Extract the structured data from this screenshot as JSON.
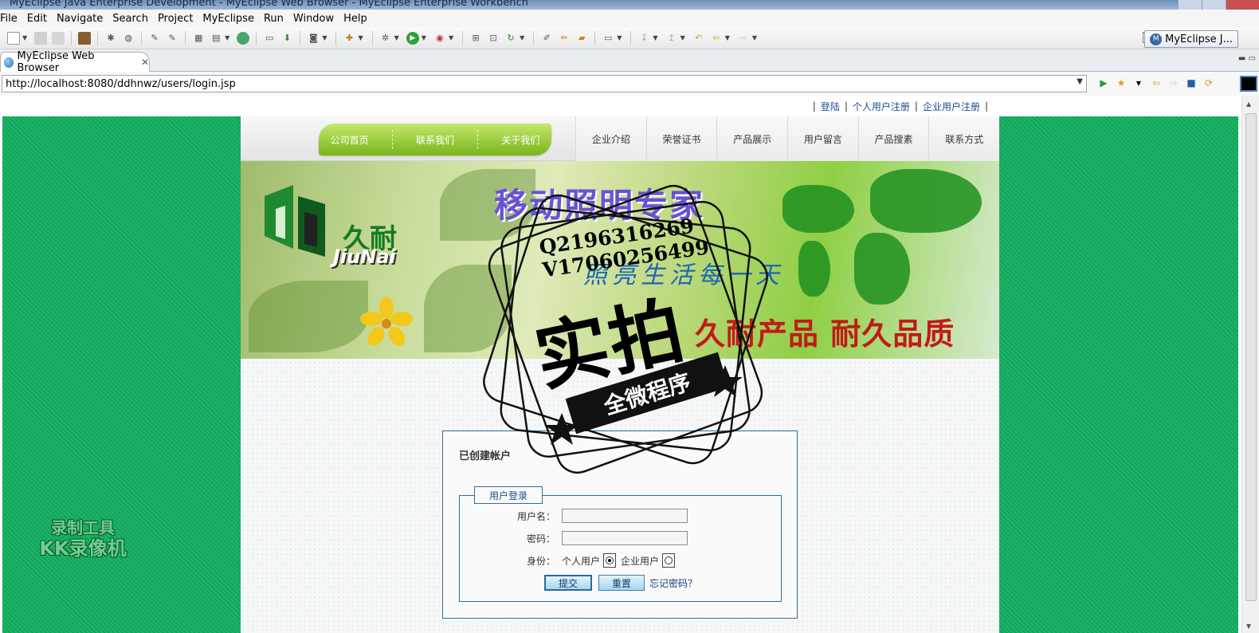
{
  "window": {
    "title": "MyEclipse Java Enterprise Development - MyEclipse Web Browser - MyEclipse Enterprise Workbench"
  },
  "menu": [
    "File",
    "Edit",
    "Navigate",
    "Search",
    "Project",
    "MyEclipse",
    "Run",
    "Window",
    "Help"
  ],
  "perspective": {
    "label": "MyEclipse J..."
  },
  "editor_tab": {
    "label": "MyEclipse Web Browser"
  },
  "url": "http://localhost:8080/ddhnwz/users/login.jsp",
  "toplinks": [
    "登陆",
    "个人用户注册",
    "企业用户注册"
  ],
  "nav": {
    "green": [
      "公司首页",
      "联系我们",
      "关于我们"
    ],
    "right": [
      "企业介绍",
      "荣誉证书",
      "产品展示",
      "用户留言",
      "产品搜素",
      "联系方式"
    ]
  },
  "banner": {
    "logo_cn": "久耐",
    "logo_en": "JiuNai",
    "title": "移动照明专家",
    "slogan": "照亮生活每一天",
    "tagline": "久耐产品 耐久品质"
  },
  "login": {
    "section_title": "已创建帐户",
    "legend": "用户登录",
    "username_label": "用户名：",
    "username_value": "",
    "password_label": "密码：",
    "password_value": "",
    "role_label": "身份：",
    "role_options": [
      "个人用户",
      "企业用户"
    ],
    "role_selected": "个人用户",
    "submit": "提交",
    "reset": "重置",
    "forgot": "忘记密码？"
  },
  "watermark": {
    "recorder_line1": "录制工具",
    "recorder_line2": "KK录像机",
    "stamp_contact_1": "Q2196316269",
    "stamp_contact_2": "V17060256499",
    "stamp_main": "实拍",
    "stamp_band": "全微程序"
  },
  "colors": {
    "page_green": "#10a55a",
    "nav_green": "#8cc63f",
    "login_border": "#2f6f9a",
    "link_blue": "#1a4d92"
  }
}
